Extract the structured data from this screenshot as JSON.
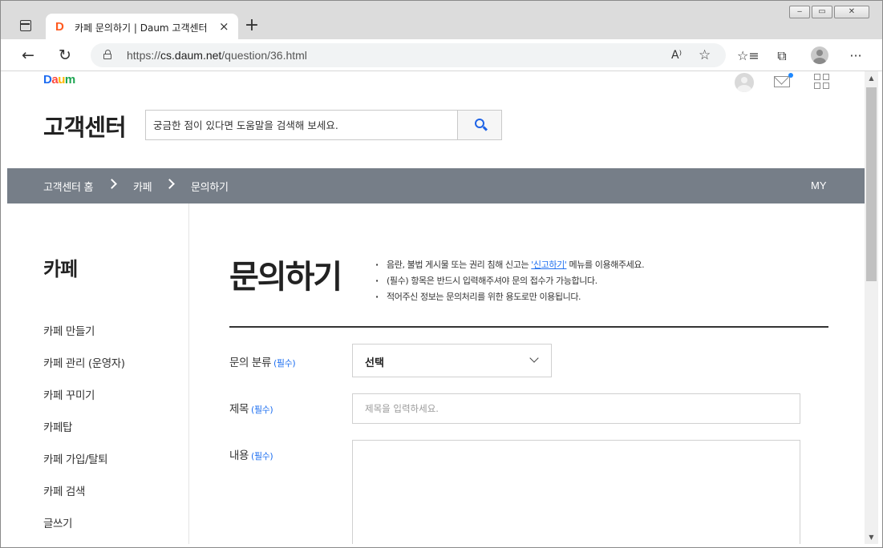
{
  "browser": {
    "tab_title": "카페 문의하기 | Daum 고객센터",
    "tab_favicon_letter": "D",
    "tab_close_glyph": "×",
    "new_tab_glyph": "+",
    "url_scheme": "https://",
    "url_host": "cs.daum.net",
    "url_path": "/question/36.html",
    "window_controls": [
      "‒",
      "▭",
      "✕"
    ],
    "nav_back_glyph": "←",
    "nav_reload_glyph": "↻",
    "read_aloud_glyph": "A⁾",
    "favorite_glyph": "☆",
    "favorites_list_glyph": "☆≡",
    "collections_glyph": "⧉",
    "more_glyph": "···",
    "scroll_up_glyph": "▲",
    "scroll_down_glyph": "▼"
  },
  "header": {
    "logo_parts": [
      "D",
      "a",
      "u",
      "m"
    ],
    "cs_title": "고객센터",
    "search_placeholder": "궁금한 점이 있다면 도움말을 검색해 보세요."
  },
  "breadcrumb": {
    "items": [
      "고객센터 홈",
      "카페",
      "문의하기"
    ],
    "my_label": "MY"
  },
  "sidebar": {
    "title": "카페",
    "items": [
      "카페 만들기",
      "카페 관리 (운영자)",
      "카페 꾸미기",
      "카페탑",
      "카페 가입/탈퇴",
      "카페 검색",
      "글쓰기"
    ]
  },
  "main": {
    "title": "문의하기",
    "notices": [
      {
        "before": "음란, 불법 게시물 또는 권리 침해 신고는 ",
        "link": "'신고하기'",
        "after": " 메뉴를 이용해주세요."
      },
      {
        "before": "(필수) 항목은 반드시 입력해주셔야 문의 접수가 가능합니다.",
        "link": "",
        "after": ""
      },
      {
        "before": "적어주신 정보는 문의처리를 위한 용도로만 이용됩니다.",
        "link": "",
        "after": ""
      }
    ],
    "form": {
      "category_label": "문의 분류",
      "subject_label": "제목",
      "content_label": "내용",
      "required_tag": "(필수)",
      "category_value": "선택",
      "subject_placeholder": "제목을 입력하세요.",
      "content_value": ""
    }
  },
  "colors": {
    "navbar_bg": "#767e88",
    "accent_blue": "#1e6ff0",
    "search_icon": "#1e63e6"
  }
}
